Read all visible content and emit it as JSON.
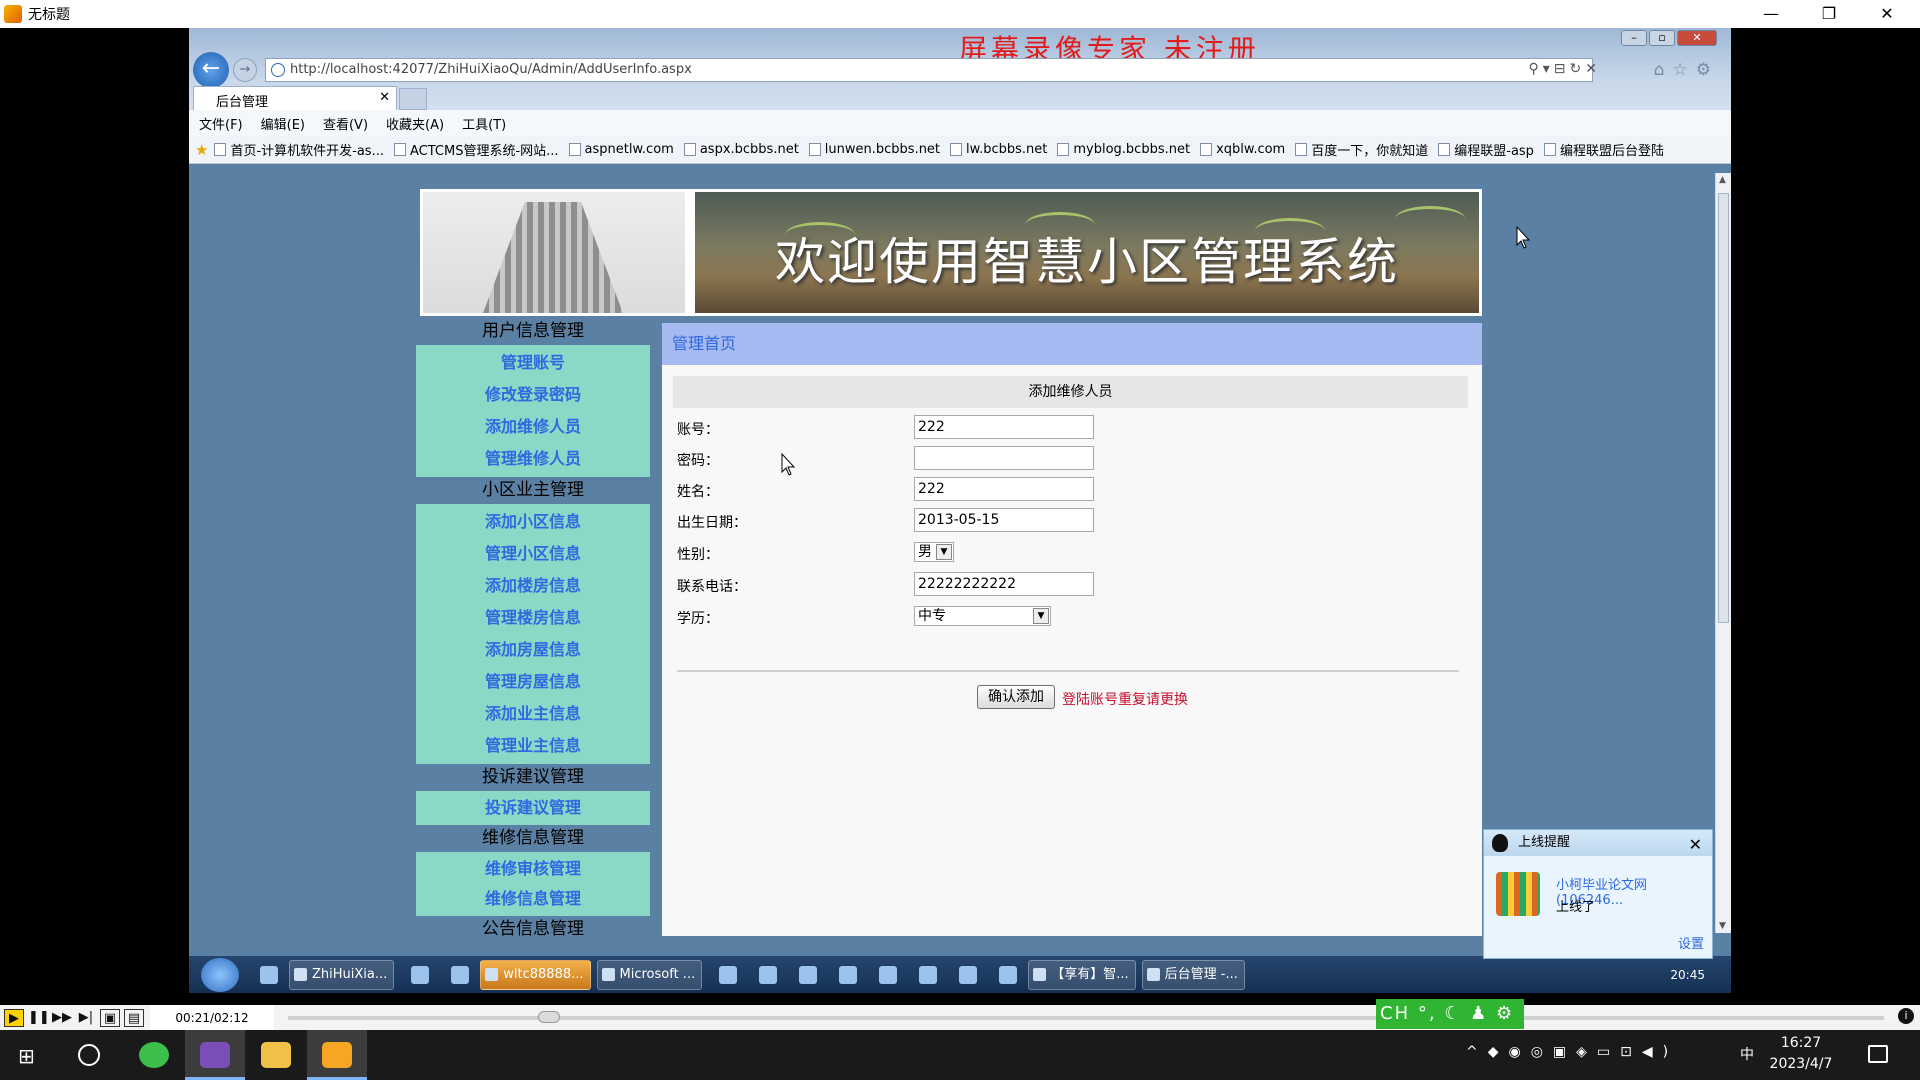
{
  "player": {
    "title": "无标题",
    "time": "00:21/02:12",
    "ime_label": "CH °, ☾ ♟ ⚙"
  },
  "recorder_banner": "屏幕录像专家 未注册",
  "browser": {
    "url": "http://localhost:42077/ZhiHuiXiaoQu/Admin/AddUserInfo.aspx",
    "tab_title": "后台管理",
    "menu": [
      "文件(F)",
      "编辑(E)",
      "查看(V)",
      "收藏夹(A)",
      "工具(T)"
    ],
    "favorites": [
      "首页-计算机软件开发-as...",
      "ACTCMS管理系统-网站...",
      "aspnetlw.com",
      "aspx.bcbbs.net",
      "lunwen.bcbbs.net",
      "lw.bcbbs.net",
      "myblog.bcbbs.net",
      "xqblw.com",
      "百度一下，你就知道",
      "编程联盟-asp",
      "编程联盟后台登陆"
    ]
  },
  "site": {
    "banner_text": "欢迎使用智慧小区管理系统",
    "nav": [
      {
        "title": "用户信息管理",
        "items": [
          "管理账号",
          "修改登录密码",
          "添加维修人员",
          "管理维修人员"
        ]
      },
      {
        "title": "小区业主管理",
        "items": [
          "添加小区信息",
          "管理小区信息",
          "添加楼房信息",
          "管理楼房信息",
          "添加房屋信息",
          "管理房屋信息",
          "添加业主信息",
          "管理业主信息"
        ]
      },
      {
        "title": "投诉建议管理",
        "items": [
          "投诉建议管理"
        ]
      },
      {
        "title": "维修信息管理",
        "items": [
          "维修审核管理",
          "维修信息管理"
        ]
      },
      {
        "title": "公告信息管理",
        "items": []
      }
    ],
    "content_head": "管理首页",
    "form": {
      "title": "添加维修人员",
      "fields": [
        {
          "label": "账号：",
          "value": "222"
        },
        {
          "label": "密码：",
          "value": ""
        },
        {
          "label": "姓名：",
          "value": "222"
        },
        {
          "label": "出生日期：",
          "value": "2013-05-15"
        },
        {
          "label": "性别：",
          "value": "男"
        },
        {
          "label": "联系电话：",
          "value": "22222222222"
        },
        {
          "label": "学历：",
          "value": "中专"
        }
      ],
      "submit": "确认添加",
      "message": "登陆账号重复请更换"
    }
  },
  "qq_popup": {
    "title": "上线提醒",
    "name": "小柯毕业论文网(106246...",
    "status": "上线了",
    "settings": "设置"
  },
  "win7_taskbar": {
    "buttons": [
      "ZhiHuiXia...",
      "wltc88888...",
      "Microsoft ...",
      "【享有】智...",
      "后台管理 -..."
    ],
    "clock": "20:45"
  },
  "win10_taskbar": {
    "time": "16:27",
    "date": "2023/4/7",
    "ime": "中"
  }
}
